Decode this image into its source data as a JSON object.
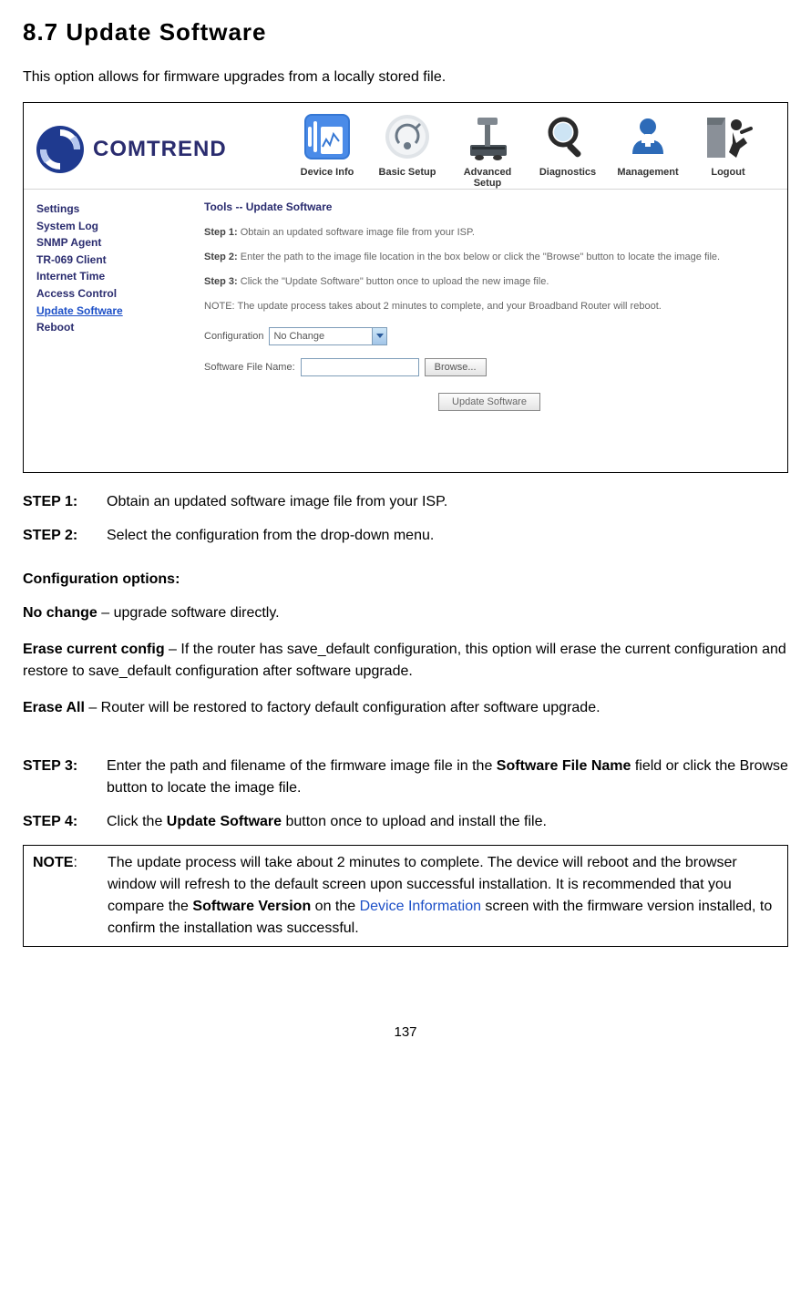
{
  "heading": "8.7 Update Software",
  "intro": "This option allows for firmware upgrades from a locally stored file.",
  "ui": {
    "brand": "COMTREND",
    "nav": {
      "device_info": "Device Info",
      "basic_setup": "Basic Setup",
      "advanced_setup": "Advanced Setup",
      "diagnostics": "Diagnostics",
      "management": "Management",
      "logout": "Logout"
    },
    "sidebar": {
      "settings": "Settings",
      "system_log": "System Log",
      "snmp_agent": "SNMP Agent",
      "tr069": "TR-069 Client",
      "internet_time": "Internet Time",
      "access_control": "Access Control",
      "update_software": "Update Software",
      "reboot": "Reboot"
    },
    "content": {
      "title": "Tools -- Update Software",
      "step1_label": "Step 1:",
      "step1": "Obtain an updated software image file from your ISP.",
      "step2_label": "Step 2:",
      "step2": "Enter the path to the image file location in the box below or click the \"Browse\" button to locate the image file.",
      "step3_label": "Step 3:",
      "step3": "Click the \"Update Software\" button once to upload the new image file.",
      "note": "NOTE: The update process takes about 2 minutes to complete, and your Broadband Router will reboot.",
      "config_label": "Configuration",
      "config_value": "No Change",
      "file_label": "Software File Name:",
      "browse_btn": "Browse...",
      "update_btn": "Update Software"
    }
  },
  "steps": {
    "s1_label": "STEP 1:",
    "s1": "Obtain an updated software image file from your ISP.",
    "s2_label": "STEP 2",
    "s2_colon": ":",
    "s2": "Select the configuration from the drop-down menu.",
    "s3_label": "STEP 3",
    "s3_colon": ":",
    "s3_a": "Enter the path and filename of the firmware image file in the ",
    "s3_b": "Software File Name",
    "s3_c": " field or click the Browse button to locate the image file.",
    "s4_label": "STEP 4",
    "s4_colon": ":",
    "s4_a": "Click the ",
    "s4_b": "Update Software",
    "s4_c": " button once to upload and install the file."
  },
  "config_opts": {
    "heading": "Configuration options:",
    "no_change_label": "No change",
    "no_change_text": " – upgrade software directly.",
    "erase_cur_label": "Erase current config",
    "erase_cur_text": " – If the router has save_default configuration, this option will erase the current configuration and restore to save_default configuration after software upgrade.",
    "erase_all_label": "Erase All",
    "erase_all_text": " – Router will be restored to factory default configuration after software upgrade."
  },
  "note": {
    "label": "NOTE",
    "colon": ":",
    "t1": "The update process will take about 2 minutes to complete.   The device will reboot and the browser window will refresh to the default screen upon successful installation. It is recommended that you compare the ",
    "t2": "Software Version",
    "t3": " on the ",
    "link": "Device Information",
    "t4": " screen with the firmware version installed, to confirm the installation was successful."
  },
  "page_num": "137"
}
